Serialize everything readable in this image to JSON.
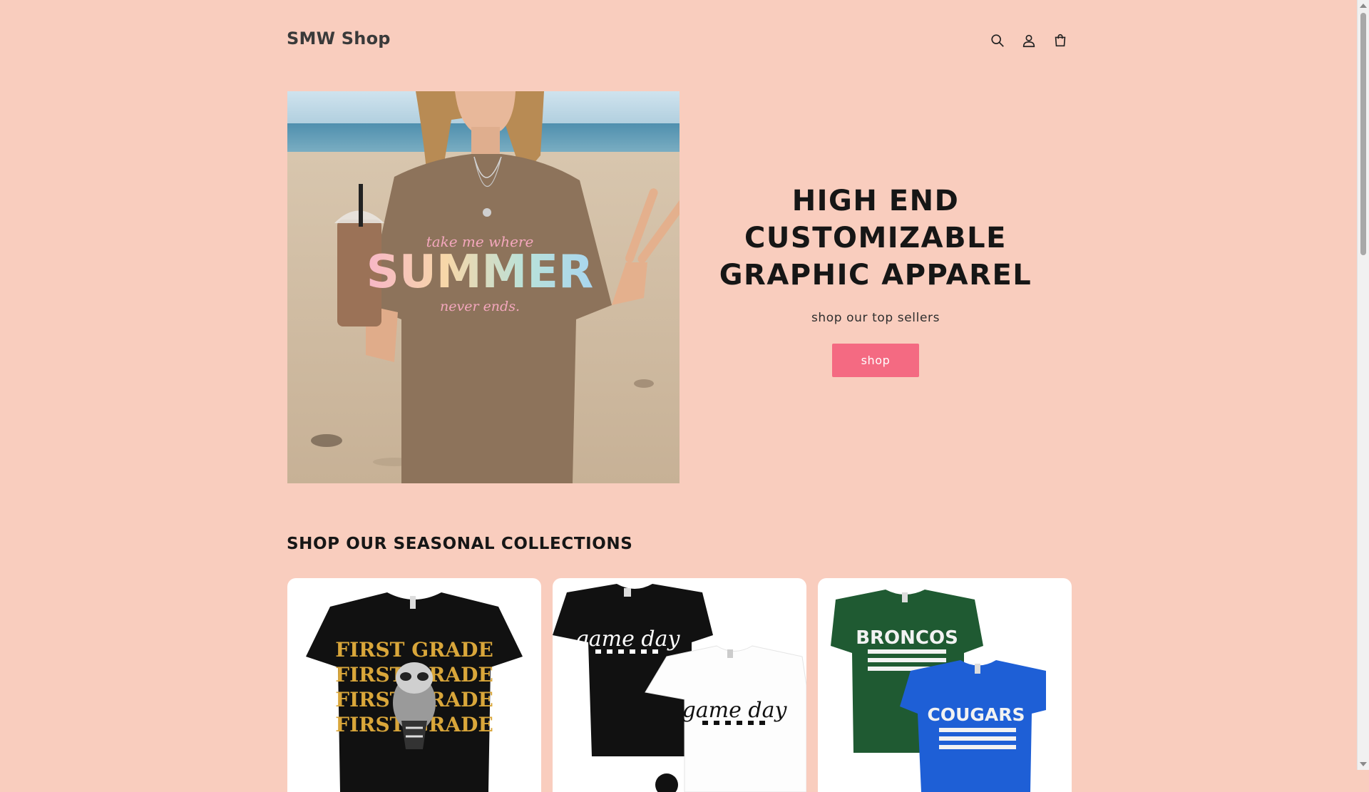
{
  "header": {
    "logo": "SMW Shop",
    "icons": [
      "search-icon",
      "account-icon",
      "cart-icon"
    ]
  },
  "hero": {
    "title": "HIGH END CUSTOMIZABLE GRAPHIC APPAREL",
    "subtitle": "shop our top sellers",
    "button_label": "shop",
    "image_text": {
      "line1": "take me where",
      "line2": "SUMMER",
      "line3": "never ends."
    }
  },
  "collections": {
    "title": "SHOP OUR SEASONAL COLLECTIONS",
    "cards": [
      {
        "shirt_text": [
          "FIRST GRADE",
          "FIRST GRADE",
          "FIRST GRADE",
          "FIRST GRADE"
        ]
      },
      {
        "shirt_text": [
          "game day",
          "game day"
        ]
      },
      {
        "shirt_text": [
          "BRONCOS",
          "COUGARS"
        ]
      }
    ]
  },
  "colors": {
    "background": "#f9cdbe",
    "button": "#f46a82",
    "text": "#161616"
  }
}
